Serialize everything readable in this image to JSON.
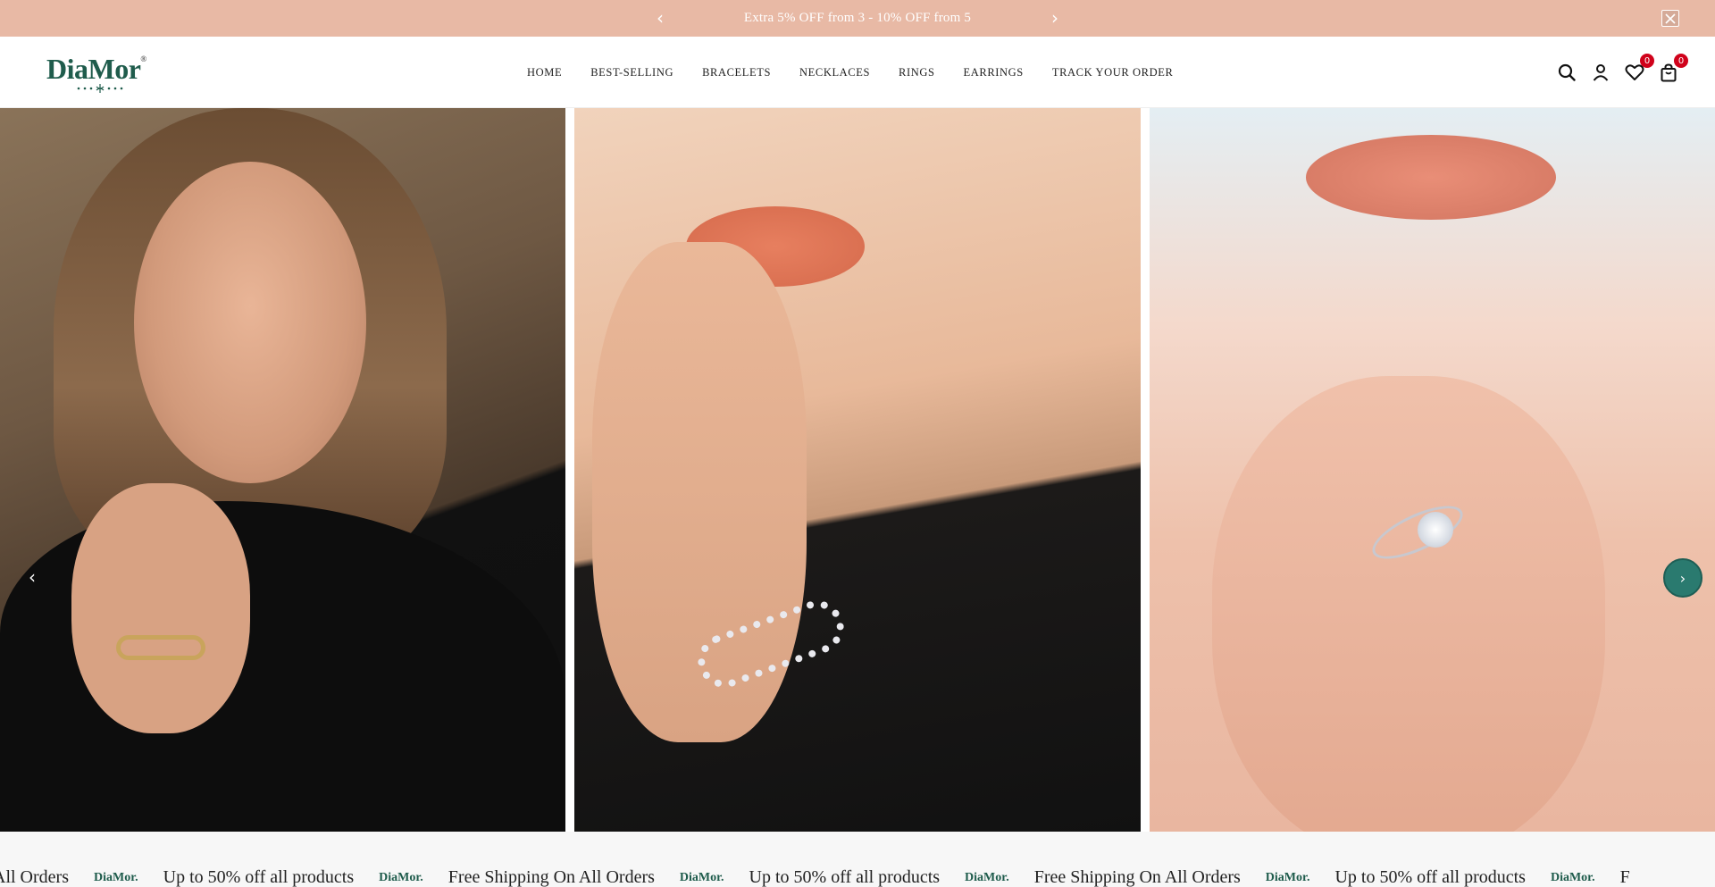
{
  "announcement": {
    "message": "Extra 5% OFF from 3 - 10% OFF from 5",
    "prev_icon": "‹",
    "next_icon": "›"
  },
  "header": {
    "logo_text": "DiaMor",
    "logo_mark": "®",
    "nav": [
      "HOME",
      "BEST-SELLING",
      "BRACELETS",
      "NECKLACES",
      "RINGS",
      "EARRINGS",
      "TRACK YOUR ORDER"
    ],
    "wishlist_count": "0",
    "cart_count": "0"
  },
  "hero": {
    "prev_icon": "‹",
    "next_icon": "›"
  },
  "marquee": {
    "items": [
      {
        "type": "text",
        "text": "All Orders"
      },
      {
        "type": "logo",
        "text": "DiaMor."
      },
      {
        "type": "text",
        "text": "Up to 50% off all products"
      },
      {
        "type": "logo",
        "text": "DiaMor."
      },
      {
        "type": "text",
        "text": "Free Shipping On All Orders"
      },
      {
        "type": "logo",
        "text": "DiaMor."
      },
      {
        "type": "text",
        "text": "Up to 50% off all products"
      },
      {
        "type": "logo",
        "text": "DiaMor."
      },
      {
        "type": "text",
        "text": "Free Shipping On All Orders"
      },
      {
        "type": "logo",
        "text": "DiaMor."
      },
      {
        "type": "text",
        "text": "Up to 50% off all products"
      },
      {
        "type": "logo",
        "text": "DiaMor."
      },
      {
        "type": "text",
        "text": "F"
      }
    ]
  },
  "colors": {
    "announcement_bg": "#e8b9a5",
    "brand_green": "#1f5c4c",
    "accent_teal": "#2a7a6f",
    "badge_red": "#d0021b"
  }
}
